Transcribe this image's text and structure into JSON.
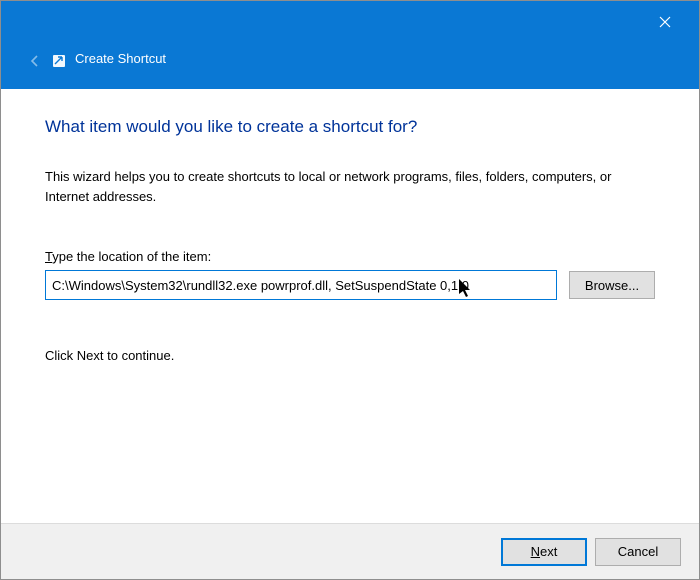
{
  "titlebar": {
    "title": "Create Shortcut"
  },
  "main": {
    "heading": "What item would you like to create a shortcut for?",
    "description": "This wizard helps you to create shortcuts to local or network programs, files, folders, computers, or Internet addresses.",
    "field_label_pre": "T",
    "field_label_rest": "ype the location of the item:",
    "location_value": "C:\\Windows\\System32\\rundll32.exe powrprof.dll, SetSuspendState 0,1,0",
    "browse_label": "Browse...",
    "continue_text": "Click Next to continue."
  },
  "footer": {
    "next_pre": "N",
    "next_rest": "ext",
    "cancel": "Cancel"
  },
  "icons": {
    "close": "close-icon",
    "back": "back-arrow-icon",
    "shortcut": "shortcut-icon",
    "cursor": "cursor-icon"
  }
}
